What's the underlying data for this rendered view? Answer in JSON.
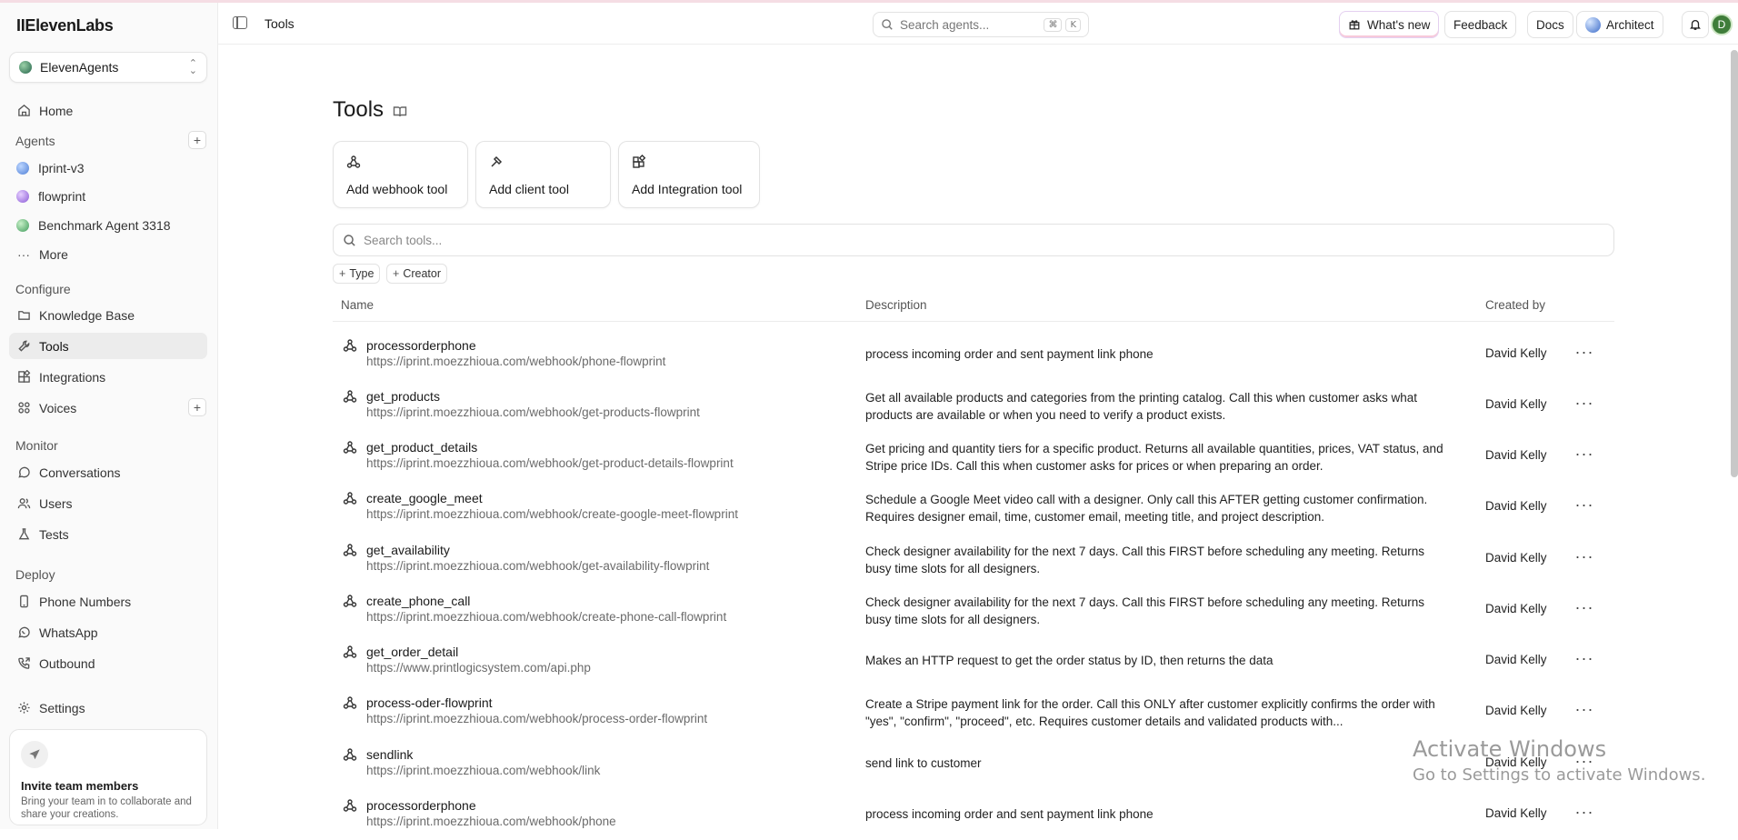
{
  "app": {
    "logo": "IIElevenLabs",
    "workspace": "ElevenAgents",
    "page_title": "Tools"
  },
  "sidebar": {
    "home": "Home",
    "agents_label": "Agents",
    "agents": [
      {
        "name": "Iprint-v3",
        "color": "#4f7fd6"
      },
      {
        "name": "flowprint",
        "color": "#8a5ad6"
      },
      {
        "name": "Benchmark Agent 3318",
        "color": "#3e9a5a"
      }
    ],
    "more": "More",
    "configure_label": "Configure",
    "configure": [
      "Knowledge Base",
      "Tools",
      "Integrations",
      "Voices"
    ],
    "monitor_label": "Monitor",
    "monitor": [
      "Conversations",
      "Users",
      "Tests"
    ],
    "deploy_label": "Deploy",
    "deploy": [
      "Phone Numbers",
      "WhatsApp",
      "Outbound"
    ],
    "settings": "Settings",
    "invite": {
      "title": "Invite team members",
      "text": "Bring your team in to collaborate and share your creations."
    }
  },
  "topbar": {
    "title": "Tools",
    "search_placeholder": "Search agents...",
    "kbd1": "⌘",
    "kbd2": "K",
    "whats_new": "What's new",
    "feedback": "Feedback",
    "docs": "Docs",
    "architect": "Architect",
    "avatar": "D"
  },
  "main": {
    "title": "Tools",
    "actions": [
      "Add webhook tool",
      "Add client tool",
      "Add Integration tool"
    ],
    "search_placeholder": "Search tools...",
    "filters": [
      "Type",
      "Creator"
    ],
    "columns": {
      "name": "Name",
      "description": "Description",
      "created_by": "Created by"
    },
    "rows": [
      {
        "name": "processorderphone",
        "url": "https://iprint.moezzhioua.com/webhook/phone-flowprint",
        "desc": "process incoming order and sent payment link phone",
        "by": "David Kelly"
      },
      {
        "name": "get_products",
        "url": "https://iprint.moezzhioua.com/webhook/get-products-flowprint",
        "desc": "Get all available products and categories from the printing catalog. Call this when customer asks what products are available or when you need to verify a product exists.",
        "by": "David Kelly"
      },
      {
        "name": "get_product_details",
        "url": "https://iprint.moezzhioua.com/webhook/get-product-details-flowprint",
        "desc": "Get pricing and quantity tiers for a specific product. Returns all available quantities, prices, VAT status, and Stripe price IDs. Call this when customer asks for prices or when preparing an order.",
        "by": "David Kelly"
      },
      {
        "name": "create_google_meet",
        "url": "https://iprint.moezzhioua.com/webhook/create-google-meet-flowprint",
        "desc": "Schedule a Google Meet video call with a designer. Only call this AFTER getting customer confirmation. Requires designer email, time, customer email, meeting title, and project description.",
        "by": "David Kelly"
      },
      {
        "name": "get_availability",
        "url": "https://iprint.moezzhioua.com/webhook/get-availability-flowprint",
        "desc": "Check designer availability for the next 7 days. Call this FIRST before scheduling any meeting. Returns busy time slots for all designers.",
        "by": "David Kelly"
      },
      {
        "name": "create_phone_call",
        "url": "https://iprint.moezzhioua.com/webhook/create-phone-call-flowprint",
        "desc": "Check designer availability for the next 7 days. Call this FIRST before scheduling any meeting. Returns busy time slots for all designers.",
        "by": "David Kelly"
      },
      {
        "name": "get_order_detail",
        "url": "https://www.printlogicsystem.com/api.php",
        "desc": "Makes an HTTP request to get the order status by ID, then returns the data",
        "by": "David Kelly"
      },
      {
        "name": "process-oder-flowprint",
        "url": "https://iprint.moezzhioua.com/webhook/process-order-flowprint",
        "desc": "Create a Stripe payment link for the order. Call this ONLY after customer explicitly confirms the order with \"yes\", \"confirm\", \"proceed\", etc. Requires customer details and validated products with...",
        "by": "David Kelly"
      },
      {
        "name": "sendlink",
        "url": "https://iprint.moezzhioua.com/webhook/link",
        "desc": "send link to customer",
        "by": "David Kelly"
      },
      {
        "name": "processorderphone",
        "url": "https://iprint.moezzhioua.com/webhook/phone",
        "desc": "process incoming order and sent payment link phone",
        "by": "David Kelly"
      }
    ]
  },
  "watermark": {
    "line1": "Activate Windows",
    "line2": "Go to Settings to activate Windows."
  }
}
